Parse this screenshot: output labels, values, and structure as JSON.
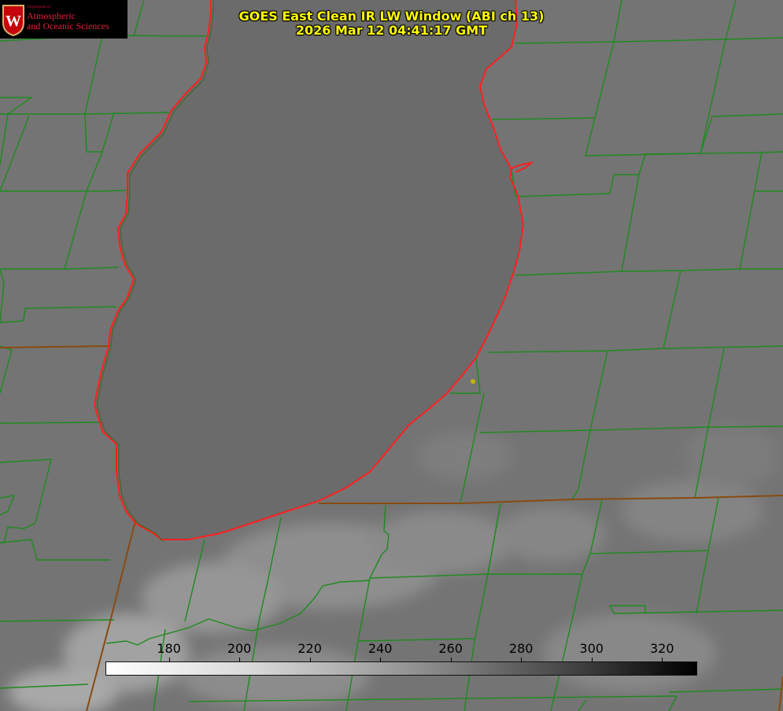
{
  "title": {
    "line1": "GOES East Clean IR LW Window (ABI ch 13)",
    "line2": "2026 Mar 12 04:41:17 GMT"
  },
  "logo": {
    "department": "Department of",
    "line1": "Atmospheric",
    "line2": "and Oceanic Sciences",
    "crest_letter": "W"
  },
  "colorbar": {
    "min": 162,
    "max": 330,
    "ticks": [
      180,
      200,
      220,
      240,
      260,
      280,
      300,
      320
    ]
  },
  "colors": {
    "lake": "#6b6b6b",
    "land": "#747474",
    "boundary_green": "#1e8a1e",
    "shoreline_red": "#ff2020",
    "title_yellow": "#ffff00",
    "marker_yellow": "#c8b400"
  }
}
